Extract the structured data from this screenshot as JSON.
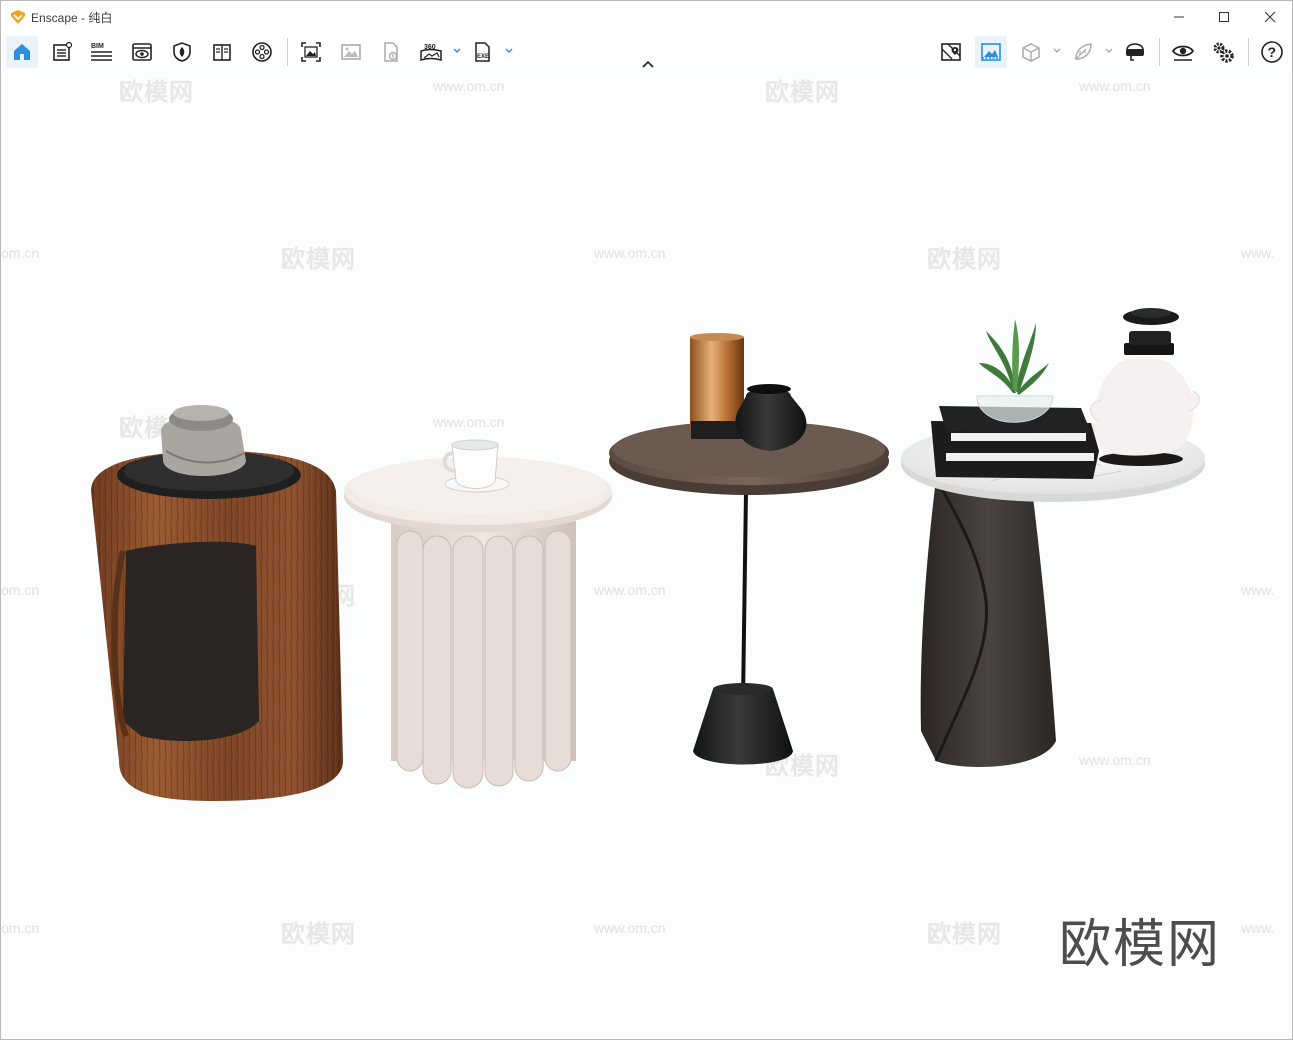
{
  "window": {
    "app_name": "Enscape",
    "separator": " - ",
    "project_name": "纯白",
    "accent_color": "#2f8fd8",
    "logo_color": "#f3a224"
  },
  "toolbar": {
    "left_group": [
      {
        "name": "home",
        "icon": "home-icon"
      },
      {
        "name": "render-settings",
        "icon": "document-settings-icon"
      },
      {
        "name": "bim",
        "icon": "bim-icon",
        "label": "BIM"
      },
      {
        "name": "views",
        "icon": "eye-window-icon"
      },
      {
        "name": "asset-library",
        "icon": "shield-leaf-icon"
      },
      {
        "name": "material-editor",
        "icon": "book-icon"
      },
      {
        "name": "video-editor",
        "icon": "film-reel-icon"
      }
    ],
    "middle_group": [
      {
        "name": "screenshot",
        "icon": "image-capture-icon"
      },
      {
        "name": "batch-render",
        "icon": "image-icon"
      },
      {
        "name": "export-file",
        "icon": "file-export-icon"
      },
      {
        "name": "panorama",
        "icon": "panorama-icon",
        "label": "360"
      },
      {
        "name": "exe-standalone",
        "icon": "exe-file-icon",
        "label": "EXE"
      }
    ],
    "right_group": [
      {
        "name": "map",
        "icon": "map-pin-icon"
      },
      {
        "name": "sky-background",
        "icon": "landscape-icon"
      },
      {
        "name": "orthographic",
        "icon": "cube-icon"
      },
      {
        "name": "vegetation",
        "icon": "leaf-icon"
      },
      {
        "name": "vr-headset",
        "icon": "vr-headset-icon"
      },
      {
        "name": "visual-settings",
        "icon": "eye-icon"
      },
      {
        "name": "general-settings",
        "icon": "gears-icon"
      },
      {
        "name": "help",
        "icon": "help-icon",
        "label": "?"
      }
    ]
  },
  "viewport": {
    "watermark_logo": "欧模网",
    "watermark_url": "www.om.cn",
    "watermark_url_fragment": "om.cn",
    "watermark_url_fragment_right": "www.",
    "brand_watermark": "欧模网"
  }
}
